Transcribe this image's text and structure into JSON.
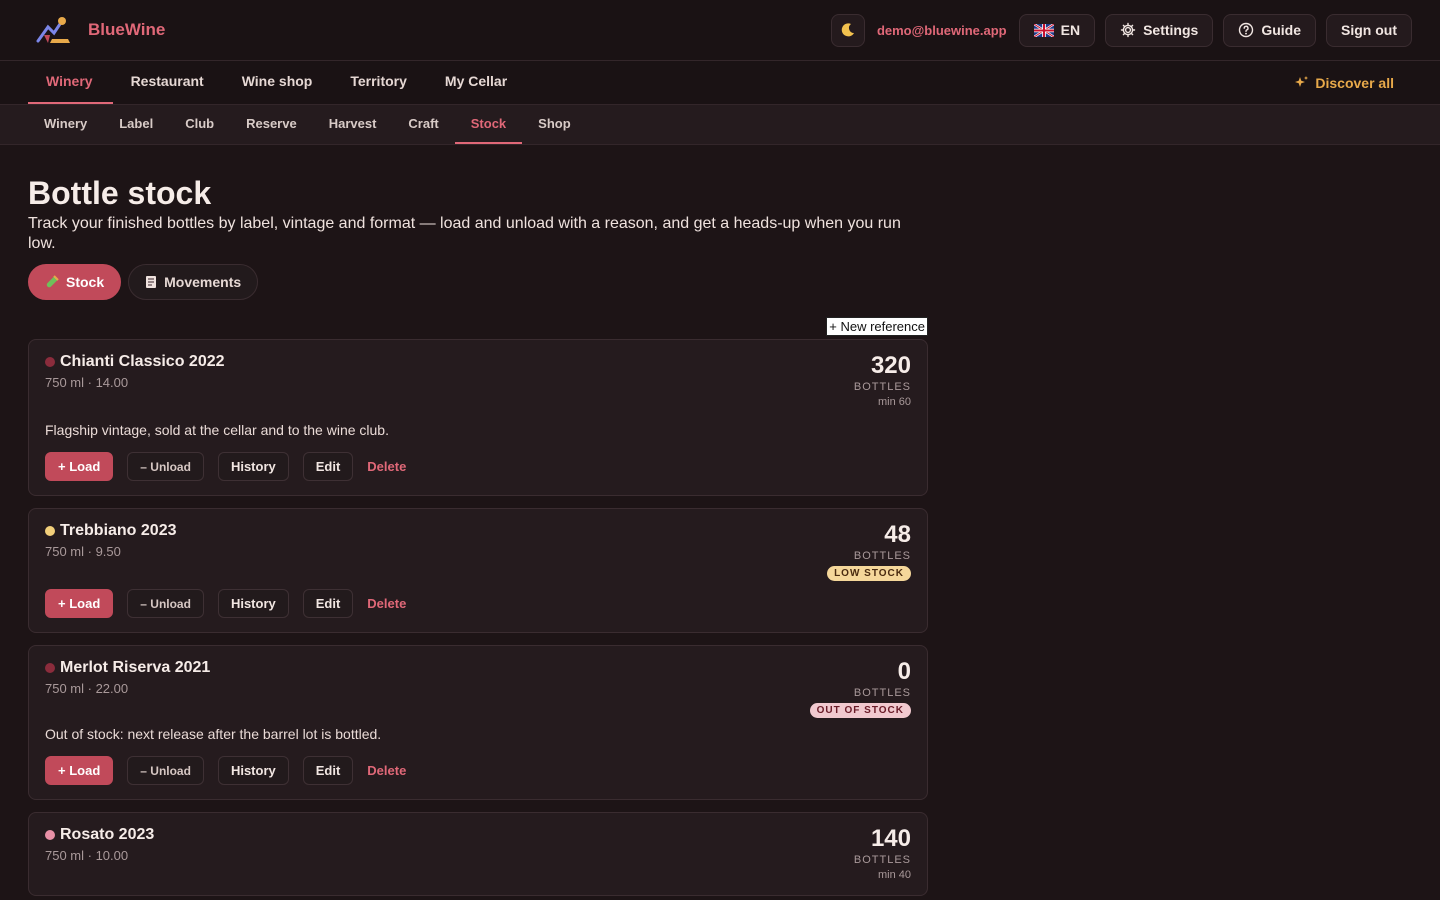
{
  "header": {
    "brand": "BlueWine",
    "user_email": "demo@bluewine.app",
    "language": "EN",
    "settings_label": "Settings",
    "guide_label": "Guide",
    "signout_label": "Sign out"
  },
  "main_nav": {
    "tabs": [
      {
        "label": "Winery",
        "active": true
      },
      {
        "label": "Restaurant",
        "active": false
      },
      {
        "label": "Wine shop",
        "active": false
      },
      {
        "label": "Territory",
        "active": false
      },
      {
        "label": "My Cellar",
        "active": false
      }
    ],
    "discover_label": "Discover all"
  },
  "sub_nav": {
    "tabs": [
      {
        "label": "Winery",
        "active": false
      },
      {
        "label": "Label",
        "active": false
      },
      {
        "label": "Club",
        "active": false
      },
      {
        "label": "Reserve",
        "active": false
      },
      {
        "label": "Harvest",
        "active": false
      },
      {
        "label": "Craft",
        "active": false
      },
      {
        "label": "Stock",
        "active": true
      },
      {
        "label": "Shop",
        "active": false
      }
    ]
  },
  "page": {
    "title": "Bottle stock",
    "subtitle": "Track your finished bottles by label, vintage and format — load and unload with a reason, and get a heads-up when you run low.",
    "toggle_stock": "Stock",
    "toggle_movements": "Movements",
    "new_reference": "+ New reference"
  },
  "actions": {
    "load": "+ Load",
    "unload": "– Unload",
    "history": "History",
    "edit": "Edit",
    "delete": "Delete"
  },
  "items": [
    {
      "name": "Chianti Classico 2022",
      "meta": "750 ml · 14.00",
      "qty": "320",
      "unit": "BOTTLES",
      "min": "min 60",
      "badge": "",
      "note": "Flagship vintage, sold at the cellar and to the wine club.",
      "dot_color": "#8b2c3c"
    },
    {
      "name": "Trebbiano 2023",
      "meta": "750 ml · 9.50",
      "qty": "48",
      "unit": "BOTTLES",
      "min": "",
      "badge": "LOW STOCK",
      "note": "",
      "dot_color": "#f2cf7a"
    },
    {
      "name": "Merlot Riserva 2021",
      "meta": "750 ml · 22.00",
      "qty": "0",
      "unit": "BOTTLES",
      "min": "",
      "badge": "OUT OF STOCK",
      "note": "Out of stock: next release after the barrel lot is bottled.",
      "dot_color": "#8b2c3c"
    },
    {
      "name": "Rosato 2023",
      "meta": "750 ml · 10.00",
      "qty": "140",
      "unit": "BOTTLES",
      "min": "min 40",
      "badge": "",
      "note": "",
      "dot_color": "#e890a6"
    }
  ],
  "colors": {
    "accent": "#e06878",
    "primary_button": "#c14a5a",
    "discover": "#e8a94a",
    "background": "#1d1416"
  }
}
